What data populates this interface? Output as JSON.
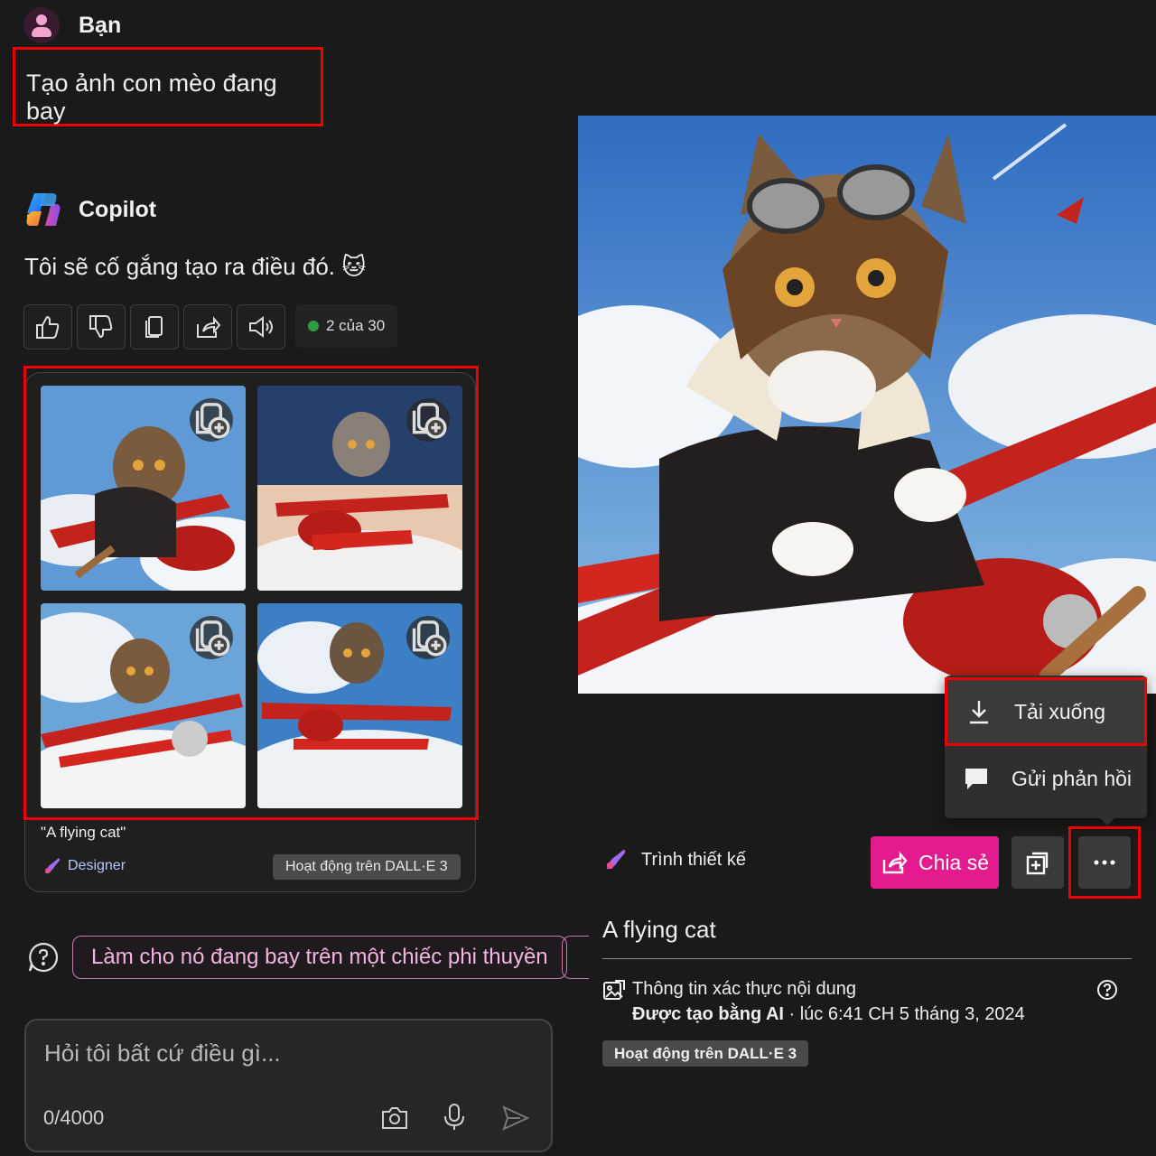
{
  "user": {
    "name": "Bạn",
    "message": "Tạo ảnh con mèo đang bay"
  },
  "copilot": {
    "name": "Copilot",
    "reply": "Tôi sẽ cố gắng tạo ra điều đó. 🐱",
    "actions": [
      "like-icon",
      "dislike-icon",
      "copy-icon",
      "share-icon",
      "speaker-icon"
    ],
    "counter": "2 của 30"
  },
  "image_card": {
    "caption": "\"A flying cat\"",
    "source": "Designer",
    "badge": "Hoạt động trên DALL·E 3"
  },
  "suggestion": "Làm cho nó đang bay trên một chiếc phi thuyền",
  "input": {
    "placeholder": "Hỏi tôi bất cứ điều gì...",
    "count": "0/4000"
  },
  "viewer": {
    "menu": {
      "download": "Tải xuống",
      "feedback": "Gửi phản hồi"
    },
    "app_name": "Trình thiết kế",
    "share": "Chia sẻ",
    "title": "A flying cat",
    "credentials_title": "Thông tin xác thực nội dung",
    "credentials_label": "Được tạo bằng AI",
    "credentials_time": " · lúc 6:41 CH 5 tháng 3, 2024",
    "badge": "Hoạt động trên DALL·E 3"
  },
  "colors": {
    "accent_pink": "#e31b8f",
    "highlight_red": "#e00000",
    "background": "#1b1a1a"
  }
}
